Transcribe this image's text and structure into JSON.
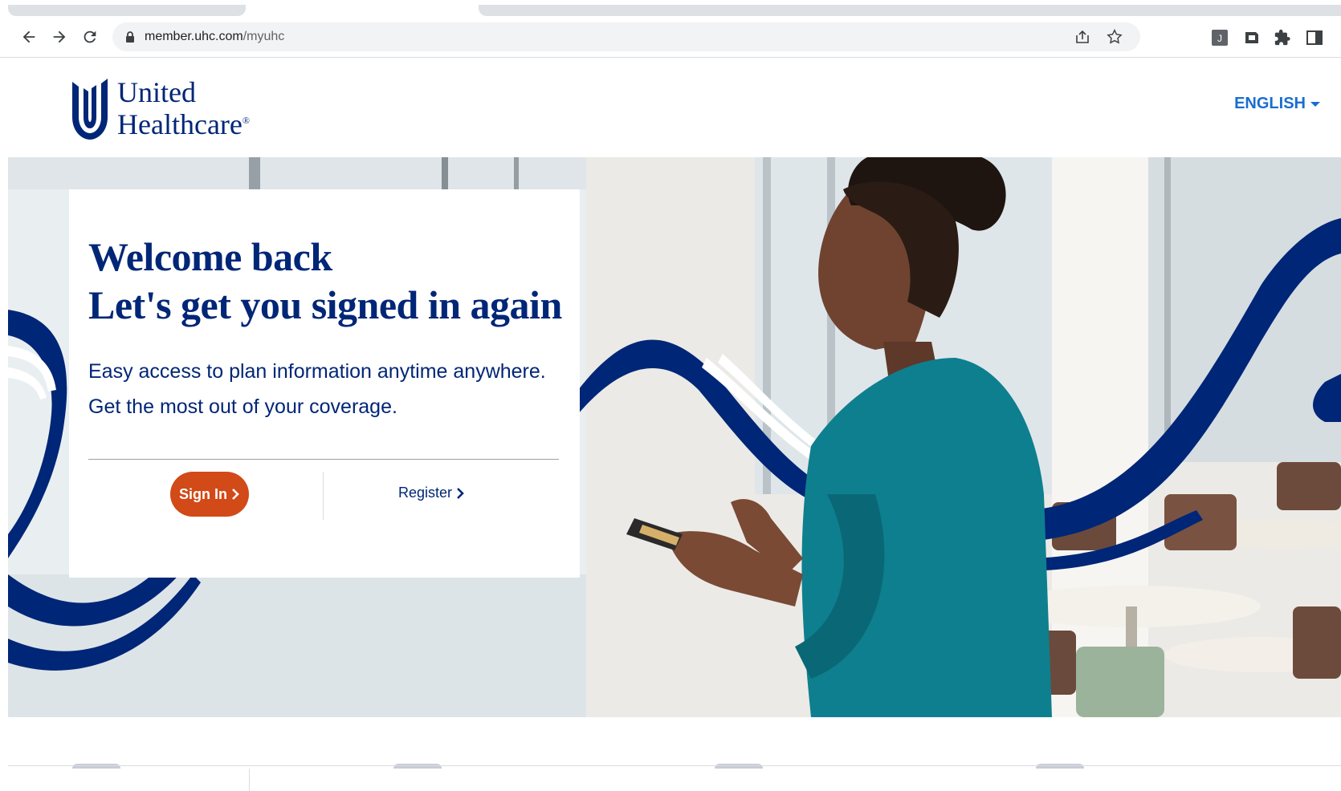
{
  "browser": {
    "url_host": "member.uhc.com",
    "url_path": "/myuhc",
    "nav_icons": [
      "back-arrow-icon",
      "forward-arrow-icon",
      "reload-icon"
    ],
    "omnibox_actions": [
      "share-icon",
      "bookmark-star-icon"
    ],
    "extensions": [
      "extension-j-icon",
      "extension-icon",
      "puzzle-piece-icon",
      "side-panel-icon"
    ]
  },
  "header": {
    "logo_line1": "United",
    "logo_line2": "Healthcare",
    "logo_reg": "®",
    "language": "ENGLISH"
  },
  "hero": {
    "title_line1": "Welcome back",
    "title_line2": "Let's get you signed in again",
    "subtitle_line1": "Easy access to plan information anytime anywhere.",
    "subtitle_line2": "Get the most out of your coverage.",
    "signin_label": "Sign In",
    "register_label": "Register"
  },
  "colors": {
    "brand_navy": "#002677",
    "signin_orange": "#d14a17",
    "link_blue": "#196ecf",
    "teal_blouse": "#0e7f8e"
  }
}
